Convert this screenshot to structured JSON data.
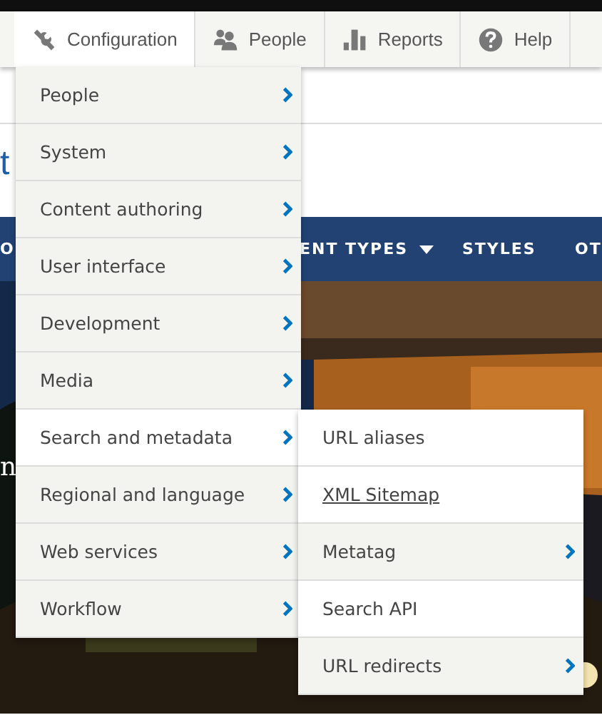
{
  "toolbar": {
    "tabs": [
      {
        "label": "Configuration",
        "kind": "wrench",
        "selected": true
      },
      {
        "label": "People",
        "kind": "people",
        "selected": false
      },
      {
        "label": "Reports",
        "kind": "bars",
        "selected": false
      },
      {
        "label": "Help",
        "kind": "help",
        "selected": false
      }
    ]
  },
  "page": {
    "site_title": "t",
    "nav": [
      {
        "label": "O",
        "kind": "link"
      },
      {
        "label": "ENT TYPES",
        "kind": "dropdown"
      },
      {
        "label": "STYLES",
        "kind": "link"
      },
      {
        "label": "OT",
        "kind": "link"
      }
    ],
    "hero_text": "n"
  },
  "menu": {
    "items": [
      {
        "label": "People",
        "selected": false,
        "has_children": true
      },
      {
        "label": "System",
        "selected": false,
        "has_children": true
      },
      {
        "label": "Content authoring",
        "selected": false,
        "has_children": true
      },
      {
        "label": "User interface",
        "selected": false,
        "has_children": true
      },
      {
        "label": "Development",
        "selected": false,
        "has_children": true
      },
      {
        "label": "Media",
        "selected": false,
        "has_children": true
      },
      {
        "label": "Search and metadata",
        "selected": true,
        "has_children": true
      },
      {
        "label": "Regional and language",
        "selected": false,
        "has_children": true
      },
      {
        "label": "Web services",
        "selected": false,
        "has_children": true
      },
      {
        "label": "Workflow",
        "selected": false,
        "has_children": true
      }
    ]
  },
  "submenu": {
    "items": [
      {
        "label": "URL aliases",
        "has_children": false,
        "hovered": false
      },
      {
        "label": "XML Sitemap",
        "has_children": false,
        "hovered": true
      },
      {
        "label": "Metatag",
        "has_children": true,
        "hovered": false
      },
      {
        "label": "Search API",
        "has_children": false,
        "hovered": false
      },
      {
        "label": "URL redirects",
        "has_children": true,
        "hovered": false
      }
    ]
  }
}
